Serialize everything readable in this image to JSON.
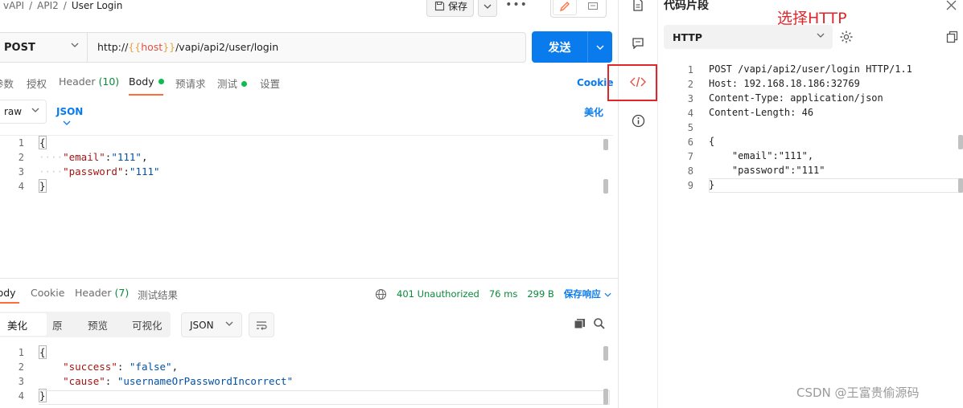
{
  "breadcrumb": {
    "items": [
      "vAPI",
      "API2"
    ],
    "current": "User Login"
  },
  "toolbar": {
    "save_label": "保存",
    "more_label": "•••"
  },
  "request": {
    "method": "POST",
    "url_prefix": "http://",
    "url_var_open": "{{",
    "url_var": "host",
    "url_var_close": "}}",
    "url_path": "/vapi/api2/user/login",
    "send_label": "发送"
  },
  "request_tabs": {
    "params": "参数",
    "auth": "授权",
    "headers": "Header",
    "headers_count": "(10)",
    "body": "Body",
    "prerequest": "预请求",
    "tests": "测试",
    "settings": "设置",
    "cookies": "Cookie"
  },
  "body_options": {
    "mode": "raw",
    "language": "JSON",
    "beautify": "美化"
  },
  "request_body": {
    "line_numbers": [
      "1",
      "2",
      "3",
      "4"
    ],
    "open": "{",
    "close": "}",
    "email_key": "\"email\"",
    "email_value": "\"111\"",
    "password_key": "\"password\"",
    "password_value": "\"111\""
  },
  "response_tabs": {
    "body": "Body",
    "cookies": "Cookie",
    "headers": "Header",
    "headers_count": "(7)",
    "test_results": "测试结果"
  },
  "response_info": {
    "status": "401 Unauthorized",
    "time": "76 ms",
    "size": "299 B",
    "save_response": "保存响应"
  },
  "response_view": {
    "pretty": "美化",
    "raw": "原",
    "preview": "预览",
    "visualize": "可视化",
    "language": "JSON"
  },
  "response_body": {
    "line_numbers": [
      "1",
      "2",
      "3",
      "4"
    ],
    "open": "{",
    "close": "}",
    "success_key": "\"success\"",
    "success_value": "\"false\"",
    "cause_key": "\"cause\"",
    "cause_value": "\"usernameOrPasswordIncorrect\""
  },
  "snippet_panel": {
    "title": "代码片段",
    "annotation": "选择HTTP",
    "language": "HTTP",
    "line_numbers": [
      "1",
      "2",
      "3",
      "4",
      "5",
      "6",
      "7",
      "8",
      "9"
    ],
    "lines": [
      "POST /vapi/api2/user/login HTTP/1.1",
      "Host: 192.168.18.186:32769",
      "Content-Type: application/json",
      "Content-Length: 46",
      "",
      "{",
      "    \"email\":\"111\",",
      "    \"password\":\"111\"",
      "}"
    ]
  },
  "watermark": "CSDN @王富贵偷源码",
  "colors": {
    "accent": "#097bed",
    "active_tab": "#ff6c37",
    "status_green": "#0a8a3a",
    "annotation_red": "#e0262b"
  }
}
